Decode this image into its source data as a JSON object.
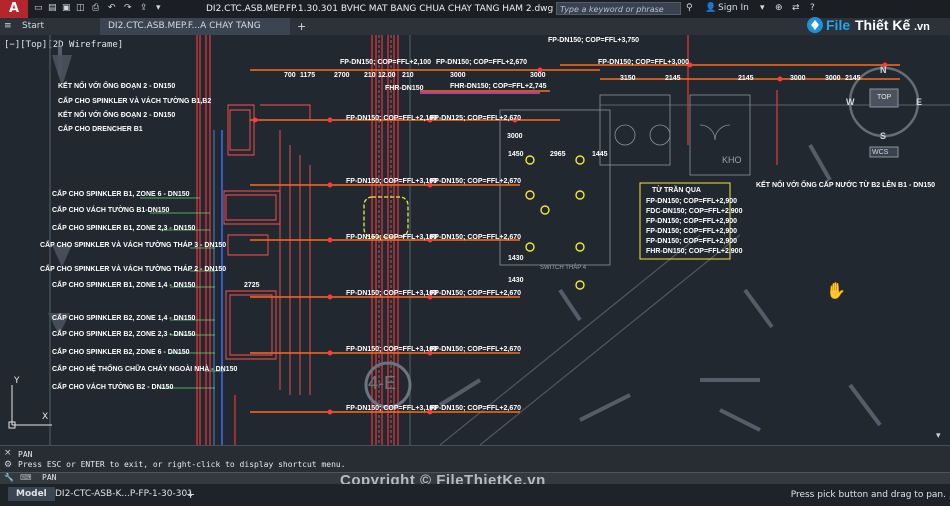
{
  "app": {
    "logo_letter": "A"
  },
  "titlebar": {
    "document_title": "DI2.CTC.ASB.MEP.FP.1.30.301 BVHC MAT BANG CHUA CHAY TANG HAM 2.dwg",
    "search_placeholder": "Type a keyword or phrase",
    "sign_in": "Sign In"
  },
  "tabs": [
    {
      "label": "Start"
    },
    {
      "label": "DI2.CTC.ASB.MEP.F...A CHAY TANG HAM 2*"
    }
  ],
  "viewport": {
    "label": "[−][Top][2D Wireframe]"
  },
  "viewcube": {
    "top": "TOP",
    "n": "N",
    "e": "E",
    "s": "S",
    "w": "W",
    "wcs": "WCS"
  },
  "brand": {
    "text1": "File",
    "text2": "Thiết Kế",
    "text3": ".vn"
  },
  "drawing": {
    "left_labels": [
      "KẾT NỐI VỚI ỐNG ĐOẠN 2 - DN150",
      "CẤP CHO SPINKLER VÀ VÁCH TƯỜNG B1,B2",
      "KẾT NỐI VỚI ỐNG ĐOẠN 2 - DN150",
      "CẤP CHO DRENCHER B1",
      "CẤP CHO SPINKLER B1, ZONE 6 - DN150",
      "CẤP CHO VÁCH TƯỜNG B1-DN150",
      "CẤP CHO SPINKLER B1, ZONE 2,3 - DN150",
      "CẤP CHO SPINKLER VÀ VÁCH TƯỜNG THÁP 3 - DN150",
      "CẤP CHO SPINKLER VÀ VÁCH TƯỜNG THÁP 2 - DN150",
      "CẤP CHO SPINKLER B1, ZONE 1,4 - DN150",
      "CẤP CHO SPINKLER B2, ZONE 1,4 - DN150",
      "CẤP CHO SPINKLER B2, ZONE 2,3 - DN150",
      "CẤP CHO SPINKLER B2, ZONE 6 - DN150",
      "CẤP CHO HỆ THỐNG CHỮA CHÁY NGOÀI NHÀ - DN150",
      "CẤP CHO VÁCH TƯỜNG B2 - DN150"
    ],
    "pipe_labels": [
      "FP-DN150; COP=FFL+3,750",
      "FP-DN150; COP=FFL+2,670",
      "FP-DN150; COP=FFL+2,100",
      "FP-DN150; COP=FFL+3,000",
      "FHR-DN150",
      "FHR-DN150; COP=FFL+2,745",
      "FP-DN150; COP=FFL+2,100",
      "FP-DN125; COP=FFL+2,670",
      "FP-DN150; COP=FFL+3,100",
      "FP-DN150; COP=FFL+2,670"
    ],
    "dims_top": [
      "700",
      "1175",
      "2700",
      "210",
      "12.00",
      "210",
      "3000",
      "3000",
      "2145",
      "3150",
      "2145",
      "3000",
      "3000",
      "2145"
    ],
    "mid_dims": [
      "3000",
      "1450",
      "2965",
      "1445",
      "1430",
      "1430",
      "2725",
      "2725",
      "2725"
    ],
    "right_note": "KẾT NỐI VỚI ỐNG CẤP NƯỚC TỪ B2 LÊN B1 - DN150",
    "riser_box": {
      "title": "TỪ TRẦN QUA",
      "lines": [
        "FP-DN150; COP=FFL+2,900",
        "FDC-DN150; COP=FFL+2,900",
        "FP-DN150; COP=FFL+2,900",
        "FP-DN150; COP=FFL+2,900",
        "FP-DN150; COP=FFL+2,900",
        "FHR-DN150; COP=FFL+2,900"
      ]
    },
    "grid_bubble": "4-E",
    "room_label": "KHO",
    "room_label2": "SWITCH THÁP 4"
  },
  "command": {
    "line1": "PAN",
    "line2": "Press ESC or ENTER to exit, or right-click to display shortcut menu.",
    "input_value": "PAN"
  },
  "status": {
    "model_tab": "Model",
    "layout_tab": "DI2-CTC-ASB-K...P-FP-1-30-301",
    "add": "+",
    "message": "Press pick button and drag to pan."
  },
  "watermark": "Copyright © FileThietKe.vn",
  "colors": {
    "background": "#212830",
    "pipe_red": "#e8383a",
    "pipe_orange": "#ff6a1a",
    "yellow": "#f2e640",
    "magenta": "#d04cc8"
  }
}
